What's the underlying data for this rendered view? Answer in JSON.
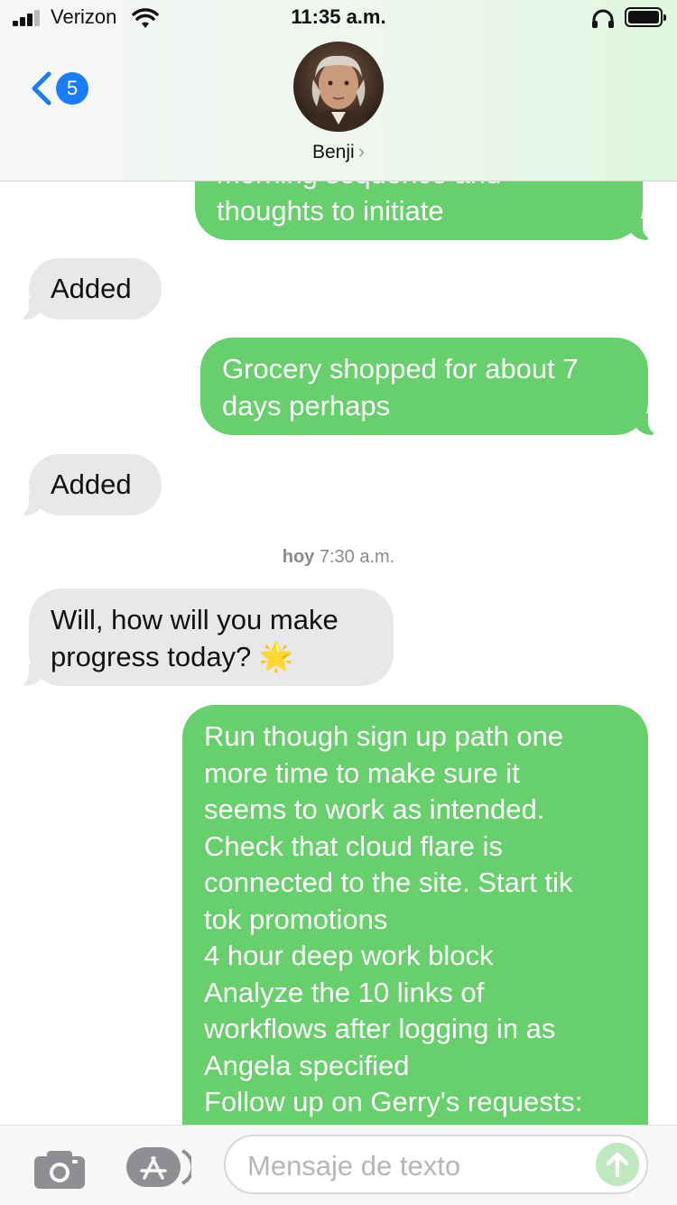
{
  "status_bar": {
    "carrier": "Verizon",
    "time": "11:35 a.m.",
    "battery_level": 1.0,
    "signal_bars": 3
  },
  "nav": {
    "unread_count": "5",
    "contact_name": "Benji",
    "chevron": "›"
  },
  "messages": [
    {
      "dir": "out",
      "lines": [
        "morning sequence and",
        "thoughts to initiate"
      ]
    },
    {
      "dir": "in",
      "lines": [
        "Added"
      ]
    },
    {
      "dir": "out",
      "lines": [
        "Grocery shopped for about 7",
        "days perhaps"
      ]
    },
    {
      "dir": "in",
      "lines": [
        "Added"
      ]
    },
    {
      "dir": "in",
      "lines": [
        "Will, how will you make",
        "progress today? 🌟"
      ]
    },
    {
      "dir": "out",
      "lines": [
        "Run though sign up path one",
        "more time to make sure it",
        "seems to work as intended.",
        "Check that cloud flare is",
        "connected to the site. Start tik",
        "tok promotions",
        "4 hour deep work block",
        "Analyze the 10 links of",
        "workflows after logging in as",
        "Angela specified",
        "Follow up on Gerry's requests:"
      ]
    }
  ],
  "timestamp": {
    "day": "hoy",
    "time": "7:30 a.m."
  },
  "input": {
    "placeholder": "Mensaje de texto"
  },
  "colors": {
    "outgoing": "#67cf6b",
    "incoming": "#e8e8ea",
    "badge": "#1a7cf7"
  },
  "icons": [
    "back-chevron-icon",
    "camera-icon",
    "app-store-icon",
    "send-arrow-icon",
    "wifi-icon",
    "headphones-icon",
    "battery-icon",
    "cellular-signal-icon"
  ]
}
